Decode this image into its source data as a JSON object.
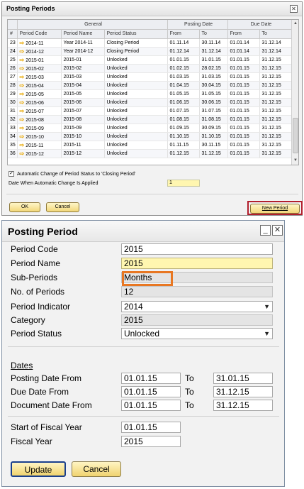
{
  "win1": {
    "title": "Posting Periods",
    "close_glyph": "✕",
    "groups": {
      "general": "General",
      "posting_date": "Posting Date",
      "due_date": "Due Date"
    },
    "columns": {
      "num": "#",
      "code": "Period Code",
      "name": "Period Name",
      "status": "Period Status",
      "from": "From",
      "to": "To"
    },
    "rows": [
      {
        "n": "23",
        "code": "2014-11",
        "name": "Year 2014-11",
        "status": "Closing Period",
        "pfrom": "01.11.14",
        "pto": "30.11.14",
        "dfrom": "01.01.14",
        "dto": "31.12.14"
      },
      {
        "n": "24",
        "code": "2014-12",
        "name": "Year 2014-12",
        "status": "Closing Period",
        "pfrom": "01.12.14",
        "pto": "31.12.14",
        "dfrom": "01.01.14",
        "dto": "31.12.14"
      },
      {
        "n": "25",
        "code": "2015-01",
        "name": "2015-01",
        "status": "Unlocked",
        "pfrom": "01.01.15",
        "pto": "31.01.15",
        "dfrom": "01.01.15",
        "dto": "31.12.15"
      },
      {
        "n": "26",
        "code": "2015-02",
        "name": "2015-02",
        "status": "Unlocked",
        "pfrom": "01.02.15",
        "pto": "28.02.15",
        "dfrom": "01.01.15",
        "dto": "31.12.15"
      },
      {
        "n": "27",
        "code": "2015-03",
        "name": "2015-03",
        "status": "Unlocked",
        "pfrom": "01.03.15",
        "pto": "31.03.15",
        "dfrom": "01.01.15",
        "dto": "31.12.15"
      },
      {
        "n": "28",
        "code": "2015-04",
        "name": "2015-04",
        "status": "Unlocked",
        "pfrom": "01.04.15",
        "pto": "30.04.15",
        "dfrom": "01.01.15",
        "dto": "31.12.15"
      },
      {
        "n": "29",
        "code": "2015-05",
        "name": "2015-05",
        "status": "Unlocked",
        "pfrom": "01.05.15",
        "pto": "31.05.15",
        "dfrom": "01.01.15",
        "dto": "31.12.15"
      },
      {
        "n": "30",
        "code": "2015-06",
        "name": "2015-06",
        "status": "Unlocked",
        "pfrom": "01.06.15",
        "pto": "30.06.15",
        "dfrom": "01.01.15",
        "dto": "31.12.15"
      },
      {
        "n": "31",
        "code": "2015-07",
        "name": "2015-07",
        "status": "Unlocked",
        "pfrom": "01.07.15",
        "pto": "31.07.15",
        "dfrom": "01.01.15",
        "dto": "31.12.15"
      },
      {
        "n": "32",
        "code": "2015-08",
        "name": "2015-08",
        "status": "Unlocked",
        "pfrom": "01.08.15",
        "pto": "31.08.15",
        "dfrom": "01.01.15",
        "dto": "31.12.15"
      },
      {
        "n": "33",
        "code": "2015-09",
        "name": "2015-09",
        "status": "Unlocked",
        "pfrom": "01.09.15",
        "pto": "30.09.15",
        "dfrom": "01.01.15",
        "dto": "31.12.15"
      },
      {
        "n": "34",
        "code": "2015-10",
        "name": "2015-10",
        "status": "Unlocked",
        "pfrom": "01.10.15",
        "pto": "31.10.15",
        "dfrom": "01.01.15",
        "dto": "31.12.15"
      },
      {
        "n": "35",
        "code": "2015-11",
        "name": "2015-11",
        "status": "Unlocked",
        "pfrom": "01.11.15",
        "pto": "30.11.15",
        "dfrom": "01.01.15",
        "dto": "31.12.15"
      },
      {
        "n": "36",
        "code": "2015-12",
        "name": "2015-12",
        "status": "Unlocked",
        "pfrom": "01.12.15",
        "pto": "31.12.15",
        "dfrom": "01.01.15",
        "dto": "31.12.15"
      }
    ],
    "row_arrow": "⇨",
    "auto_change_label": "Automatic Change of Period Status to 'Closing Period'",
    "auto_change_checked": "✓",
    "date_applied_label": "Date When Automatic Change Is Applied",
    "date_applied_value": "1",
    "ok_label": "OK",
    "cancel_label": "Cancel",
    "new_period_label": "New Period",
    "highlight_color": "#b21f2d"
  },
  "win2": {
    "title": "Posting Period",
    "min_glyph": "_",
    "close_glyph": "✕",
    "period_code_label": "Period Code",
    "period_code": "2015",
    "period_name_label": "Period Name",
    "period_name": "2015",
    "sub_periods_label": "Sub-Periods",
    "sub_periods": "Months",
    "num_periods_label": "No. of Periods",
    "num_periods": "12",
    "period_indicator_label": "Period Indicator",
    "period_indicator": "2014",
    "category_label": "Category",
    "category": "2015",
    "period_status_label": "Period Status",
    "period_status": "Unlocked",
    "dropdown_glyph": "▼",
    "dates_heading": "Dates",
    "to_label": "To",
    "posting_from_label": "Posting Date From",
    "posting_from": "01.01.15",
    "posting_to": "31.01.15",
    "due_from_label": "Due Date From",
    "due_from": "01.01.15",
    "due_to": "31.12.15",
    "doc_from_label": "Document Date From",
    "doc_from": "01.01.15",
    "doc_to": "31.12.15",
    "fiscal_start_label": "Start of Fiscal Year",
    "fiscal_start": "01.01.15",
    "fiscal_year_label": "Fiscal Year",
    "fiscal_year": "2015",
    "update_label": "Update",
    "cancel_label": "Cancel",
    "highlight_color": "#e87722"
  }
}
